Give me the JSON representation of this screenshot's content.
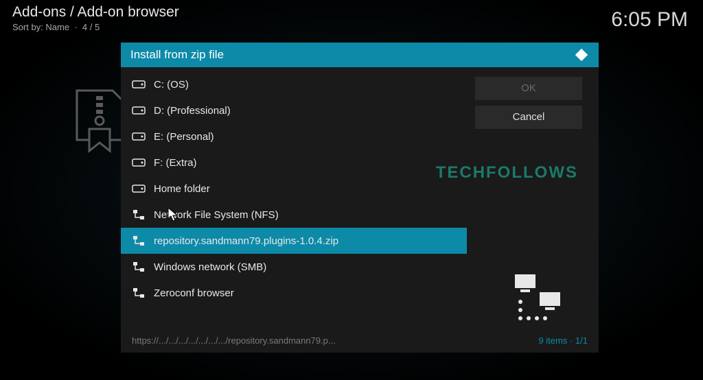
{
  "header": {
    "breadcrumb": "Add-ons / Add-on browser",
    "sort_label": "Sort by: Name",
    "position": "4 / 5"
  },
  "clock": "6:05 PM",
  "dialog": {
    "title": "Install from zip file",
    "items": [
      {
        "label": "C: (OS)",
        "icon": "hdd"
      },
      {
        "label": "D: (Professional)",
        "icon": "hdd"
      },
      {
        "label": "E: (Personal)",
        "icon": "hdd"
      },
      {
        "label": "F: (Extra)",
        "icon": "hdd"
      },
      {
        "label": "Home folder",
        "icon": "hdd"
      },
      {
        "label": "Network File System (NFS)",
        "icon": "net"
      },
      {
        "label": "repository.sandmann79.plugins-1.0.4.zip",
        "icon": "net",
        "selected": true
      },
      {
        "label": "Windows network (SMB)",
        "icon": "net"
      },
      {
        "label": "Zeroconf browser",
        "icon": "net"
      }
    ],
    "buttons": {
      "ok": "OK",
      "cancel": "Cancel"
    },
    "footer": {
      "path": "https://.../.../.../.../.../.../.../repository.sandmann79.p...",
      "items": "9 items",
      "page": "1/1"
    }
  },
  "watermark": "TECHFOLLOWS"
}
